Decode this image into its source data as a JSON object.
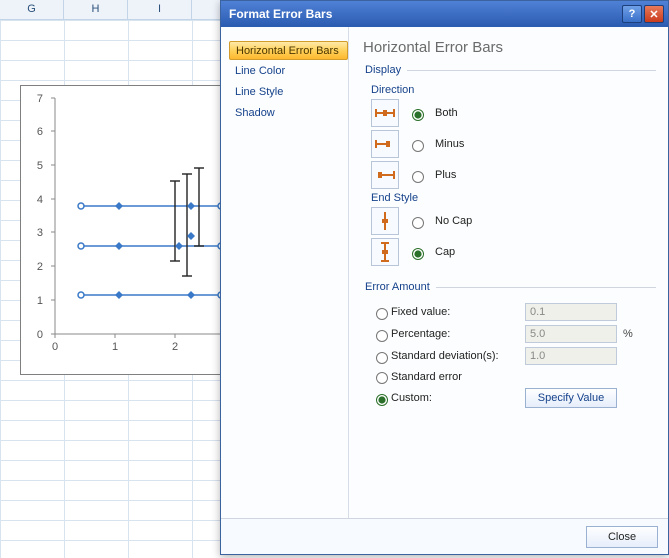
{
  "spreadsheet": {
    "columns": [
      "G",
      "H",
      "I"
    ]
  },
  "chart_data": {
    "type": "scatter",
    "points": [
      {
        "x": 1.0,
        "y": 1.15
      },
      {
        "x": 2.2,
        "y": 1.15
      },
      {
        "x": 1.0,
        "y": 2.6
      },
      {
        "x": 2.0,
        "y": 2.6
      },
      {
        "x": 2.2,
        "y": 2.9
      },
      {
        "x": 1.0,
        "y": 3.75
      },
      {
        "x": 2.2,
        "y": 3.75
      }
    ],
    "error_bars_x": {
      "mode": "custom",
      "range": [
        1,
        3
      ]
    },
    "error_bars_y": {
      "mode": "custom",
      "range": [
        0.5,
        1.2
      ]
    },
    "xlabel": "",
    "ylabel": "",
    "xlim": [
      0,
      3
    ],
    "ylim": [
      0,
      7
    ],
    "x_ticks": [
      0,
      1,
      2
    ],
    "y_ticks": [
      0,
      1,
      2,
      3,
      4,
      5,
      6,
      7
    ]
  },
  "dialog": {
    "title": "Format Error Bars",
    "nav": {
      "items": [
        {
          "label": "Horizontal Error Bars",
          "selected": true
        },
        {
          "label": "Line Color",
          "selected": false
        },
        {
          "label": "Line Style",
          "selected": false
        },
        {
          "label": "Shadow",
          "selected": false
        }
      ]
    },
    "pane_title": "Horizontal Error Bars",
    "display_legend": "Display",
    "direction_label": "Direction",
    "direction_options": {
      "both": "Both",
      "minus": "Minus",
      "plus": "Plus",
      "selected": "both"
    },
    "endstyle_label": "End Style",
    "endstyle_options": {
      "nocap": "No Cap",
      "cap": "Cap",
      "selected": "cap"
    },
    "error_amount_legend": "Error Amount",
    "amounts": {
      "fixed_label": "Fixed value:",
      "fixed_value": "0.1",
      "percentage_label": "Percentage:",
      "percentage_value": "5.0",
      "percent_sign": "%",
      "stddev_label": "Standard deviation(s):",
      "stddev_value": "1.0",
      "stderr_label": "Standard error",
      "custom_label": "Custom:",
      "specify_label": "Specify Value",
      "selected": "custom"
    },
    "close_label": "Close",
    "help_symbol": "?",
    "close_symbol": "✕"
  }
}
